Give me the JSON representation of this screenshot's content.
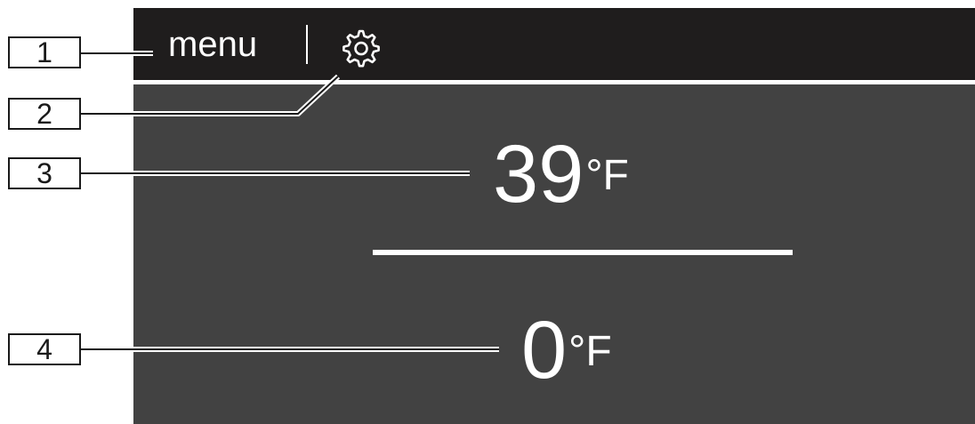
{
  "display": {
    "menu_label": "menu",
    "settings_icon": "gear-icon",
    "fridge_temp": "39",
    "fridge_unit": "°F",
    "freezer_temp": "0",
    "freezer_unit": "°F"
  },
  "callouts": [
    "1",
    "2",
    "3",
    "4"
  ],
  "colors": {
    "screen_background": "#424242",
    "topbar_background": "#1f1d1d",
    "foreground": "#ffffff",
    "callout_border": "#1a1a1a"
  }
}
